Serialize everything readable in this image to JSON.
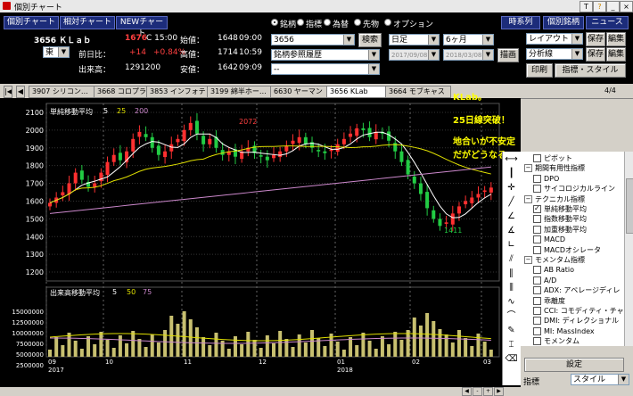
{
  "window": {
    "title": "個別チャート"
  },
  "toolbar": {
    "btn_individual": "個別チャート",
    "btn_relative": "相対チャート",
    "btn_new": "NEWチャート",
    "btn_timeseries": "時系列",
    "btn_stockinfo": "個別銘柄",
    "btn_news": "ニュース"
  },
  "quote": {
    "code_name": "3656 ＫＬａｂ",
    "price": "1676",
    "close_time": "C 15:00",
    "open_label": "始値：",
    "open_val": "1648",
    "open_time": "09:00",
    "market": "東",
    "prev_label": "前日比：",
    "change": "+14",
    "change_pct": "+0.84%",
    "high_label": "高値：",
    "high_val": "1714",
    "high_time": "10:59",
    "volume_label": "出来高：",
    "volume_val": "1291200",
    "low_label": "安値：",
    "low_val": "1642",
    "low_time": "09:09"
  },
  "radio": {
    "items": [
      "銘柄",
      "指標",
      "為替",
      "先物",
      "オプション"
    ],
    "selected": "銘柄"
  },
  "search": {
    "code_value": "3656",
    "search_btn": "検索",
    "ref_history": "銘柄参照履歴",
    "dash": "--"
  },
  "period": {
    "interval": "日足",
    "range": "6ヶ月",
    "from": "2017/09/08",
    "to": "2018/03/08",
    "draw": "描画"
  },
  "layout": {
    "layout_label": "レイアウト",
    "save": "保存",
    "edit": "編集",
    "analysis_label": "分析線",
    "save2": "保存",
    "edit2": "編集",
    "print": "印刷",
    "style": "指標・スタイル>>"
  },
  "tabs": [
    "3907 シリコン…",
    "3668 コロプラ",
    "3853 インフォテリ",
    "3199 綿半ホー…",
    "6630 ヤーマン",
    "3656 KLab",
    "3664 モブキャス"
  ],
  "active_tab": "3656 KLab",
  "page_indicator": "4/4",
  "chart": {
    "ma_label": "単純移動平均",
    "ma_periods": [
      "5",
      "25",
      "200"
    ],
    "vol_label": "出来高移動平均",
    "vol_periods": [
      "5",
      "50",
      "75"
    ],
    "price_max_label": "2072",
    "price_min_label": "1411",
    "colors": {
      "up": "#ff3030",
      "down": "#22cc44",
      "ma5": "#ffffff",
      "ma25": "#e0e000",
      "ma200": "#cc88cc",
      "volume": "#c8c070"
    }
  },
  "annotation": {
    "line1": "KLab。",
    "line2": "25日線突破！",
    "line3": "地合いが不安定だがどうなる。"
  },
  "indicators": {
    "items": [
      {
        "label": "ピボット",
        "type": "cb",
        "checked": false,
        "indent": 1
      },
      {
        "label": "期間有用性指標",
        "type": "group",
        "indent": 0
      },
      {
        "label": "DPO",
        "type": "cb",
        "checked": false,
        "indent": 1
      },
      {
        "label": "サイコロジカルライン",
        "type": "cb",
        "checked": false,
        "indent": 1
      },
      {
        "label": "テクニカル指標",
        "type": "group",
        "indent": 0
      },
      {
        "label": "単純移動平均",
        "type": "cb",
        "checked": true,
        "indent": 1
      },
      {
        "label": "指数移動平均",
        "type": "cb",
        "checked": false,
        "indent": 1
      },
      {
        "label": "加重移動平均",
        "type": "cb",
        "checked": false,
        "indent": 1
      },
      {
        "label": "MACD",
        "type": "cb",
        "checked": false,
        "indent": 1
      },
      {
        "label": "MACDオシレータ",
        "type": "cb",
        "checked": false,
        "indent": 1
      },
      {
        "label": "モメンタム指標",
        "type": "group",
        "indent": 0
      },
      {
        "label": "AB Ratio",
        "type": "cb",
        "checked": false,
        "indent": 1
      },
      {
        "label": "A/D",
        "type": "cb",
        "checked": false,
        "indent": 1
      },
      {
        "label": "ADX: アベレージディレ",
        "type": "cb",
        "checked": false,
        "indent": 1
      },
      {
        "label": "乖離度",
        "type": "cb",
        "checked": false,
        "indent": 1
      },
      {
        "label": "CCI: コモディティ・チャ",
        "type": "cb",
        "checked": false,
        "indent": 1
      },
      {
        "label": "DMI: ディレクショナル",
        "type": "cb",
        "checked": false,
        "indent": 1
      },
      {
        "label": "MI: MassIndex",
        "type": "cb",
        "checked": false,
        "indent": 1
      },
      {
        "label": "モメンタム",
        "type": "cb",
        "checked": false,
        "indent": 1
      }
    ],
    "settings_btn": "設定",
    "footer_label": "指標",
    "footer_select": "スタイル"
  },
  "x_axis": {
    "months": [
      "09",
      "10",
      "11",
      "12",
      "01",
      "02",
      "03"
    ],
    "years": [
      "2017",
      "2018"
    ]
  },
  "chart_data": {
    "type": "line",
    "title": "",
    "y_ticks": [
      1200,
      1300,
      1400,
      1500,
      1600,
      1700,
      1800,
      1900,
      2000,
      2100
    ],
    "vol_ticks": [
      "15000000",
      "12500000",
      "10000000",
      "7500000",
      "5000000",
      "2500000"
    ],
    "close_series": [
      1590,
      1620,
      1650,
      1700,
      1760,
      1720,
      1680,
      1700,
      1760,
      1820,
      1860,
      1830,
      1880,
      1950,
      1990,
      1960,
      1900,
      1860,
      1880,
      1920,
      1950,
      2000,
      2040,
      1980,
      1920,
      1950,
      1900,
      1860,
      1880,
      1850,
      1880,
      1900,
      1870,
      1850,
      1830,
      1860,
      1880,
      1910,
      1940,
      1960,
      1920,
      1900,
      1880,
      1870,
      1890,
      1920,
      1950,
      1980,
      2010,
      2000,
      1960,
      1990,
      1980,
      1940,
      1880,
      1820,
      1750,
      1700,
      1640,
      1560,
      1500,
      1460,
      1480,
      1530,
      1570,
      1600,
      1620,
      1640,
      1660,
      1676
    ],
    "ylim": [
      1150,
      2150
    ]
  }
}
